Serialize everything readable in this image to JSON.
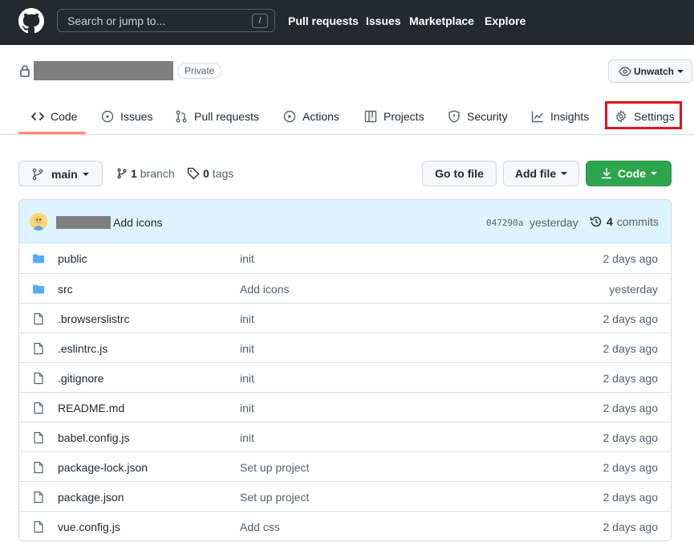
{
  "header": {
    "search_placeholder": "Search or jump to...",
    "search_shortcut": "/",
    "nav": [
      "Pull requests",
      "Issues",
      "Marketplace",
      "Explore"
    ]
  },
  "repo": {
    "visibility_badge": "Private",
    "watch_label": "Unwatch"
  },
  "tabs": [
    {
      "label": "Code",
      "icon": "code-icon",
      "selected": true
    },
    {
      "label": "Issues",
      "icon": "issue-opened-icon"
    },
    {
      "label": "Pull requests",
      "icon": "git-pull-request-icon"
    },
    {
      "label": "Actions",
      "icon": "play-icon"
    },
    {
      "label": "Projects",
      "icon": "table-icon"
    },
    {
      "label": "Security",
      "icon": "shield-icon"
    },
    {
      "label": "Insights",
      "icon": "graph-icon"
    },
    {
      "label": "Settings",
      "icon": "gear-icon",
      "highlighted": true
    }
  ],
  "toolbar": {
    "branch": "main",
    "branch_count": "1",
    "branch_word": "branch",
    "tag_count": "0",
    "tag_word": "tags",
    "go_to_file": "Go to file",
    "add_file": "Add file",
    "code": "Code"
  },
  "latest_commit": {
    "message": "Add icons",
    "sha": "047290a",
    "time": "yesterday",
    "commit_count": "4",
    "commit_word": "commits"
  },
  "files": [
    {
      "name": "public",
      "type": "folder",
      "message": "init",
      "age": "2 days ago"
    },
    {
      "name": "src",
      "type": "folder",
      "message": "Add icons",
      "age": "yesterday"
    },
    {
      "name": ".browserslistrc",
      "type": "file",
      "message": "init",
      "age": "2 days ago"
    },
    {
      "name": ".eslintrc.js",
      "type": "file",
      "message": "init",
      "age": "2 days ago"
    },
    {
      "name": ".gitignore",
      "type": "file",
      "message": "init",
      "age": "2 days ago"
    },
    {
      "name": "README.md",
      "type": "file",
      "message": "init",
      "age": "2 days ago"
    },
    {
      "name": "babel.config.js",
      "type": "file",
      "message": "init",
      "age": "2 days ago"
    },
    {
      "name": "package-lock.json",
      "type": "file",
      "message": "Set up project",
      "age": "2 days ago"
    },
    {
      "name": "package.json",
      "type": "file",
      "message": "Set up project",
      "age": "2 days ago"
    },
    {
      "name": "vue.config.js",
      "type": "file",
      "message": "Add css",
      "age": "2 days ago"
    }
  ],
  "colors": {
    "header_bg": "#24292f",
    "accent_green": "#2da44e",
    "highlight_red": "#e0131d",
    "commit_bar_bg": "#ddf4ff",
    "folder_blue": "#54aeff"
  }
}
